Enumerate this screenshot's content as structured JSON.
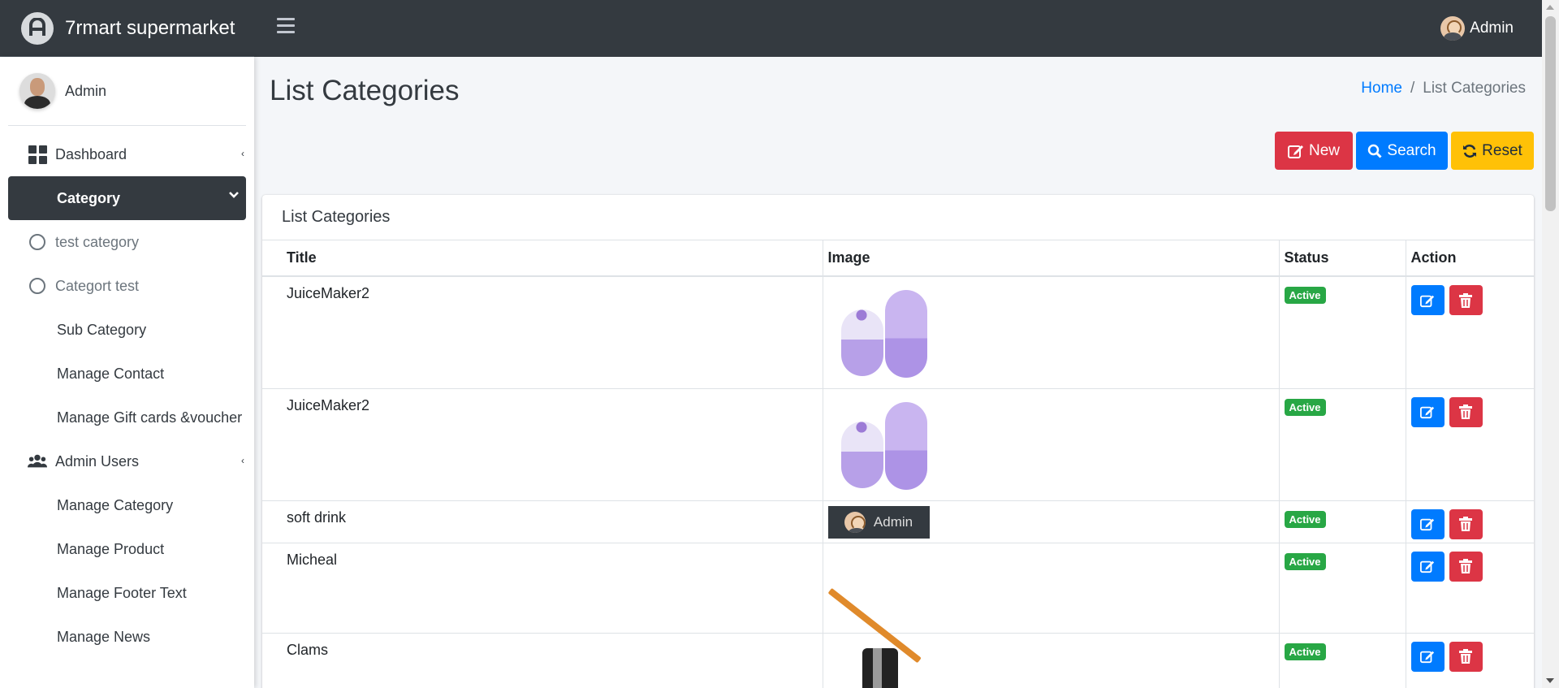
{
  "app": {
    "brand": "7rmart supermarket",
    "top_user": "Admin"
  },
  "sidebar": {
    "user_name": "Admin",
    "items": [
      {
        "label": "Dashboard",
        "icon": "dashboard-grid-icon"
      },
      {
        "label": "Category",
        "icon": "chevron-down-icon",
        "active": true
      },
      {
        "label": "test category",
        "icon": "circle-icon"
      },
      {
        "label": "Categort test",
        "icon": "circle-icon"
      },
      {
        "label": "Sub Category"
      },
      {
        "label": "Manage Contact"
      },
      {
        "label": "Manage Gift cards &voucher"
      },
      {
        "label": "Admin Users",
        "icon": "users-icon"
      },
      {
        "label": "Manage Category"
      },
      {
        "label": "Manage Product"
      },
      {
        "label": "Manage Footer Text"
      },
      {
        "label": "Manage News"
      }
    ]
  },
  "page": {
    "title": "List Categories",
    "breadcrumb_home": "Home",
    "breadcrumb_sep": "/",
    "breadcrumb_current": "List Categories"
  },
  "toolbar": {
    "new_label": "New",
    "search_label": "Search",
    "reset_label": "Reset"
  },
  "card": {
    "title": "List Categories"
  },
  "table": {
    "headers": [
      "Title",
      "Image",
      "Status",
      "Action"
    ],
    "rows": [
      {
        "title": "JuiceMaker2",
        "image": "purple-pods",
        "status": "Active"
      },
      {
        "title": "JuiceMaker2",
        "image": "purple-pods",
        "status": "Active"
      },
      {
        "title": "soft drink",
        "image": "admin-banner",
        "image_text": "Admin",
        "status": "Active"
      },
      {
        "title": "Micheal",
        "image": "pencil",
        "status": "Active"
      },
      {
        "title": "Clams",
        "image": "coffee-grinder",
        "status": "Active"
      }
    ]
  },
  "colors": {
    "navbar": "#343a40",
    "primary": "#007bff",
    "danger": "#dc3545",
    "warning": "#ffc107",
    "success": "#28a745"
  }
}
